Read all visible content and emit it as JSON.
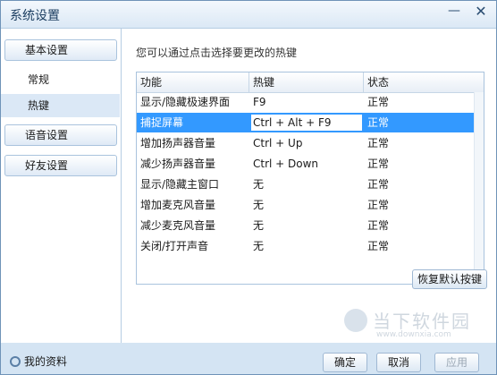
{
  "window": {
    "title": "系统设置",
    "min_icon": "—",
    "close_icon": "✕"
  },
  "sidebar": {
    "groups": [
      {
        "label": "基本设置"
      },
      {
        "label": "语音设置"
      },
      {
        "label": "好友设置"
      }
    ],
    "sub_items": [
      {
        "label": "常规",
        "active": false
      },
      {
        "label": "热键",
        "active": true
      }
    ]
  },
  "main": {
    "hint": "您可以通过点击选择要更改的热键",
    "table": {
      "headers": [
        "功能",
        "热键",
        "状态"
      ],
      "rows": [
        {
          "function": "显示/隐藏极速界面",
          "hotkey": "F9",
          "status": "正常"
        },
        {
          "function": "捕捉屏幕",
          "hotkey": "Ctrl + Alt + F9",
          "status": "正常",
          "selected": true
        },
        {
          "function": "增加扬声器音量",
          "hotkey": "Ctrl + Up",
          "status": "正常"
        },
        {
          "function": "减少扬声器音量",
          "hotkey": "Ctrl + Down",
          "status": "正常"
        },
        {
          "function": "显示/隐藏主窗口",
          "hotkey": "无",
          "status": "正常"
        },
        {
          "function": "增加麦克风音量",
          "hotkey": "无",
          "status": "正常"
        },
        {
          "function": "减少麦克风音量",
          "hotkey": "无",
          "status": "正常"
        },
        {
          "function": "关闭/打开声音",
          "hotkey": "无",
          "status": "正常"
        }
      ]
    },
    "restore_label": "恢复默认按键"
  },
  "footer": {
    "profile_label": "我的资料",
    "ok_label": "确定",
    "cancel_label": "取消",
    "apply_label": "应用"
  },
  "watermark": {
    "text": "当下软件园",
    "url": "www.downxia.com"
  }
}
